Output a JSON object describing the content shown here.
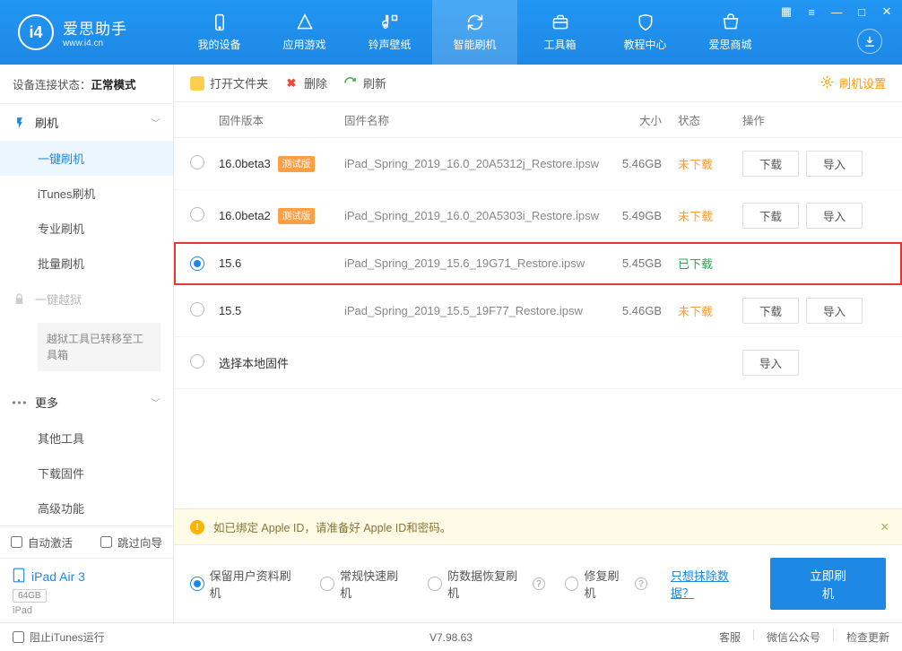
{
  "app": {
    "title": "爱思助手",
    "url": "www.i4.cn"
  },
  "nav": {
    "tabs": [
      {
        "label": "我的设备"
      },
      {
        "label": "应用游戏"
      },
      {
        "label": "铃声壁纸"
      },
      {
        "label": "智能刷机"
      },
      {
        "label": "工具箱"
      },
      {
        "label": "教程中心"
      },
      {
        "label": "爱思商城"
      }
    ],
    "activeIndex": 3
  },
  "sidebar": {
    "statusLabel": "设备连接状态：",
    "statusValue": "正常模式",
    "flash": {
      "header": "刷机",
      "items": [
        "一键刷机",
        "iTunes刷机",
        "专业刷机",
        "批量刷机"
      ],
      "activeIndex": 0
    },
    "jailbreak": {
      "header": "一键越狱",
      "notice": "越狱工具已转移至工具箱"
    },
    "more": {
      "header": "更多",
      "items": [
        "其他工具",
        "下载固件",
        "高级功能"
      ]
    },
    "autoActivate": "自动激活",
    "skipGuide": "跳过向导",
    "device": {
      "name": "iPad Air 3",
      "storage": "64GB",
      "model": "iPad"
    }
  },
  "toolbar": {
    "open": "打开文件夹",
    "delete": "删除",
    "refresh": "刷新",
    "settings": "刷机设置"
  },
  "table": {
    "headers": {
      "version": "固件版本",
      "name": "固件名称",
      "size": "大小",
      "status": "状态",
      "action": "操作"
    },
    "actions": {
      "download": "下载",
      "import": "导入"
    },
    "statuses": {
      "notDownloaded": "未下载",
      "downloaded": "已下载"
    },
    "rows": [
      {
        "version": "16.0beta3",
        "beta": "测试版",
        "name": "iPad_Spring_2019_16.0_20A5312j_Restore.ipsw",
        "size": "5.46GB",
        "status": "notDownloaded",
        "selected": false,
        "showActions": true
      },
      {
        "version": "16.0beta2",
        "beta": "测试版",
        "name": "iPad_Spring_2019_16.0_20A5303i_Restore.ipsw",
        "size": "5.49GB",
        "status": "notDownloaded",
        "selected": false,
        "showActions": true
      },
      {
        "version": "15.6",
        "beta": null,
        "name": "iPad_Spring_2019_15.6_19G71_Restore.ipsw",
        "size": "5.45GB",
        "status": "downloaded",
        "selected": true,
        "showActions": false
      },
      {
        "version": "15.5",
        "beta": null,
        "name": "iPad_Spring_2019_15.5_19F77_Restore.ipsw",
        "size": "5.46GB",
        "status": "notDownloaded",
        "selected": false,
        "showActions": true
      }
    ],
    "localRow": "选择本地固件"
  },
  "warning": "如已绑定 Apple ID，请准备好 Apple ID和密码。",
  "flashOptions": {
    "keepData": "保留用户资料刷机",
    "normal": "常规快速刷机",
    "antiRecover": "防数据恢复刷机",
    "repair": "修复刷机",
    "eraseLink": "只想抹除数据？",
    "flashNow": "立即刷机",
    "selectedIndex": 0
  },
  "footer": {
    "blockItunes": "阻止iTunes运行",
    "version": "V7.98.63",
    "support": "客服",
    "wechat": "微信公众号",
    "update": "检查更新"
  }
}
